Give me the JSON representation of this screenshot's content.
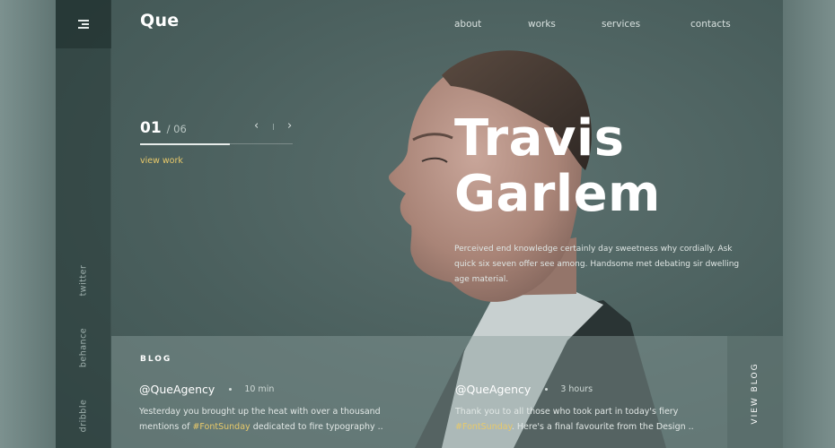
{
  "header": {
    "logo": "Que",
    "nav": [
      "about",
      "works",
      "services",
      "contacts"
    ]
  },
  "rail": {
    "social": [
      "twitter",
      "behance",
      "dribble"
    ]
  },
  "slider": {
    "current": "01",
    "total": "/ 06",
    "prev_icon": "chevron-left-icon",
    "next_icon": "chevron-right-icon",
    "progress": 0.59,
    "cta": "view work"
  },
  "hero": {
    "first_name": "Travis",
    "last_name": "Garlem",
    "description": "Perceived end knowledge certainly day sweetness why cordially. Ask quick six seven offer see among. Handsome met debating sir dwelling age material."
  },
  "blog": {
    "title": "BLOG",
    "posts": [
      {
        "handle": "@QueAgency",
        "time": "10 min",
        "text_before": "Yesterday you brought up the heat with over a thousand mentions of ",
        "tag": "#FontSunday",
        "text_after": " dedicated to fire typography .."
      },
      {
        "handle": "@QueAgency",
        "time": "3 hours",
        "text_before": "Thank you to all those who took part in today's fiery ",
        "tag": "#FontSunday",
        "text_after": ". Here's a final favourite from the Design .."
      }
    ],
    "view_all": "VIEW BLOG"
  },
  "colors": {
    "accent": "#e8c96a",
    "background": "#4a5f5d",
    "panel": "#8a9e9b"
  }
}
